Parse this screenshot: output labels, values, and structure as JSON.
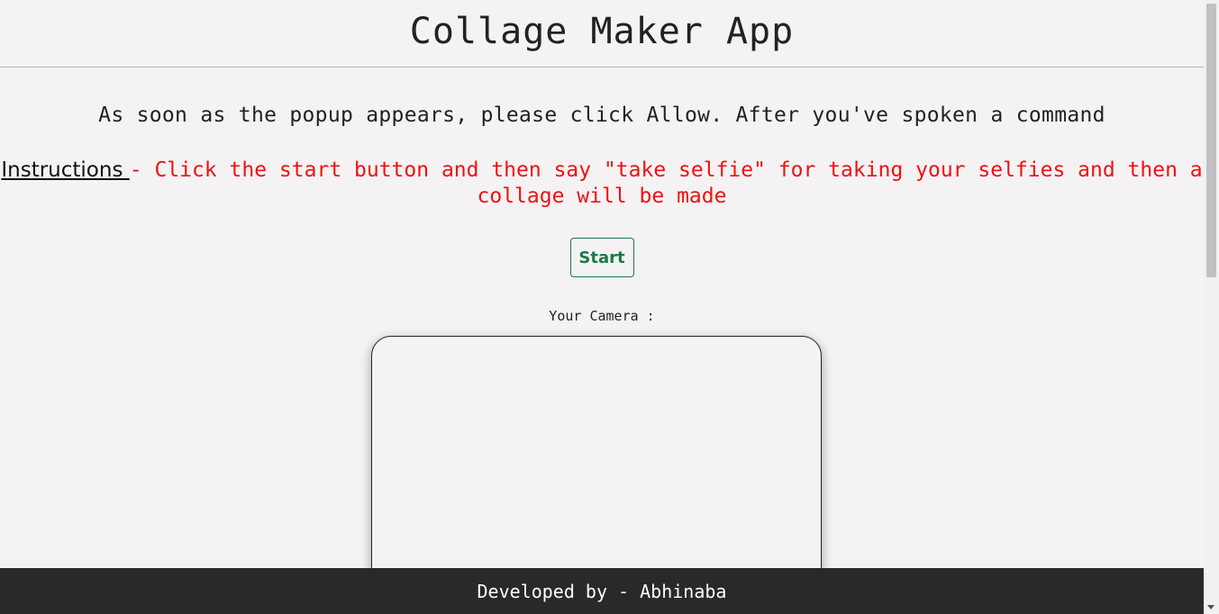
{
  "header": {
    "title": "Collage Maker App"
  },
  "intro": {
    "text": "As soon as the popup appears, please click Allow. After you've spoken a command"
  },
  "instructions": {
    "label": "Instructions ",
    "text": "- Click the start button and then say \"take selfie\" for taking your selfies and then a collage will be made"
  },
  "controls": {
    "start_label": "Start"
  },
  "camera": {
    "label": "Your Camera :"
  },
  "footer": {
    "text": "Developed by - Abhinaba"
  },
  "colors": {
    "instruction_text": "#ee1111",
    "start_button": "#1d7a45",
    "footer_bg": "#2a2829",
    "page_bg": "#f4f2f3"
  }
}
